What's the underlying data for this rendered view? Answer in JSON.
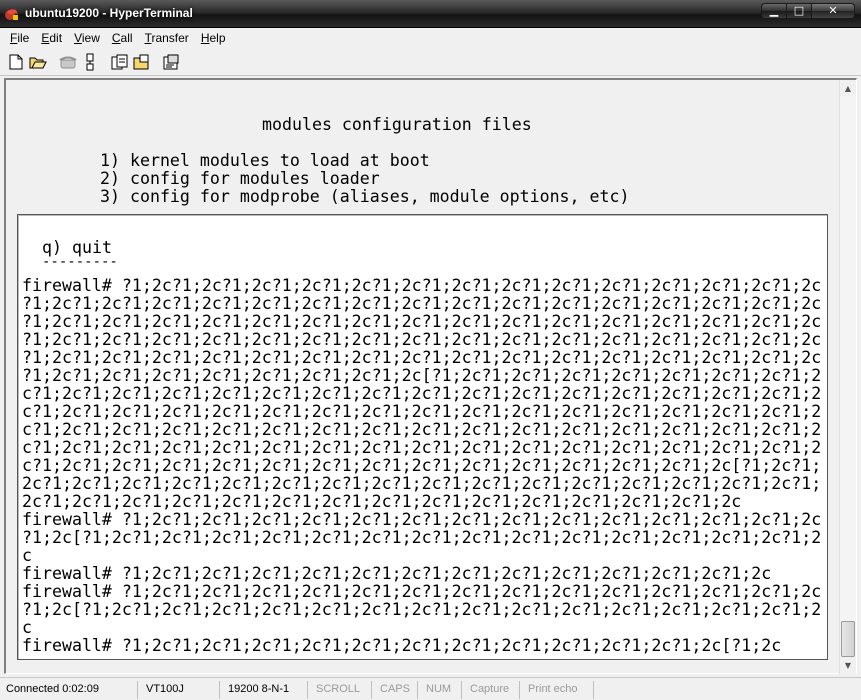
{
  "window": {
    "title": "ubuntu19200 - HyperTerminal",
    "buttons": {
      "minimize": "▁",
      "maximize": "□",
      "close": "✕"
    }
  },
  "menu": [
    "File",
    "Edit",
    "View",
    "Call",
    "Transfer",
    "Help"
  ],
  "toolbar": {
    "icons": [
      "new-document-icon",
      "open-folder-icon",
      "phone-icon",
      "disconnect-icon",
      "send-icon",
      "receive-icon",
      "properties-icon"
    ]
  },
  "terminal": {
    "menu_screen": {
      "heading": "modules configuration files",
      "options": [
        "1) kernel modules to load at boot",
        "2) config for modules loader",
        "3) config for modprobe (aliases, module options, etc)"
      ],
      "quit": "q) quit",
      "underline": "---------"
    },
    "lines": [
      "firewall# ?1;2c?1;2c?1;2c?1;2c?1;2c?1;2c?1;2c?1;2c?1;2c?1;2c?1;2c?1;2c?1;2c?1;2c",
      "?1;2c?1;2c?1;2c?1;2c?1;2c?1;2c?1;2c?1;2c?1;2c?1;2c?1;2c?1;2c?1;2c?1;2c?1;2c?1;2c",
      "?1;2c?1;2c?1;2c?1;2c?1;2c?1;2c?1;2c?1;2c?1;2c?1;2c?1;2c?1;2c?1;2c?1;2c?1;2c?1;2c",
      "?1;2c?1;2c?1;2c?1;2c?1;2c?1;2c?1;2c?1;2c?1;2c?1;2c?1;2c?1;2c?1;2c?1;2c?1;2c?1;2c",
      "?1;2c?1;2c?1;2c?1;2c?1;2c?1;2c?1;2c?1;2c?1;2c?1;2c?1;2c?1;2c?1;2c?1;2c?1;2c?1;2c",
      "?1;2c?1;2c?1;2c?1;2c?1;2c?1;2c?1;2c?1;2c[?1;2c?1;2c?1;2c?1;2c?1;2c?1;2c?1;2c?1;2",
      "c?1;2c?1;2c?1;2c?1;2c?1;2c?1;2c?1;2c?1;2c?1;2c?1;2c?1;2c?1;2c?1;2c?1;2c?1;2c?1;2",
      "c?1;2c?1;2c?1;2c?1;2c?1;2c?1;2c?1;2c?1;2c?1;2c?1;2c?1;2c?1;2c?1;2c?1;2c?1;2c?1;2",
      "c?1;2c?1;2c?1;2c?1;2c?1;2c?1;2c?1;2c?1;2c?1;2c?1;2c?1;2c?1;2c?1;2c?1;2c?1;2c?1;2",
      "c?1;2c?1;2c?1;2c?1;2c?1;2c?1;2c?1;2c?1;2c?1;2c?1;2c?1;2c?1;2c?1;2c?1;2c?1;2c?1;2",
      "c?1;2c?1;2c?1;2c?1;2c?1;2c?1;2c?1;2c?1;2c?1;2c?1;2c?1;2c?1;2c?1;2c?1;2c[?1;2c?1;",
      "2c?1;2c?1;2c?1;2c?1;2c?1;2c?1;2c?1;2c?1;2c?1;2c?1;2c?1;2c?1;2c?1;2c?1;2c?1;2c?1;",
      "2c?1;2c?1;2c?1;2c?1;2c?1;2c?1;2c?1;2c?1;2c?1;2c?1;2c?1;2c?1;2c?1;2c?1;2c",
      "firewall# ?1;2c?1;2c?1;2c?1;2c?1;2c?1;2c?1;2c?1;2c?1;2c?1;2c?1;2c?1;2c?1;2c?1;2c",
      "?1;2c[?1;2c?1;2c?1;2c?1;2c?1;2c?1;2c?1;2c?1;2c?1;2c?1;2c?1;2c?1;2c?1;2c?1;2c?1;2",
      "c",
      "firewall# ?1;2c?1;2c?1;2c?1;2c?1;2c?1;2c?1;2c?1;2c?1;2c?1;2c?1;2c?1;2c?1;2c",
      "firewall# ?1;2c?1;2c?1;2c?1;2c?1;2c?1;2c?1;2c?1;2c?1;2c?1;2c?1;2c?1;2c?1;2c?1;2c",
      "?1;2c[?1;2c?1;2c?1;2c?1;2c?1;2c?1;2c?1;2c?1;2c?1;2c?1;2c?1;2c?1;2c?1;2c?1;2c?1;2",
      "c",
      "firewall# ?1;2c?1;2c?1;2c?1;2c?1;2c?1;2c?1;2c?1;2c?1;2c?1;2c?1;2c?1;2c[?1;2c"
    ]
  },
  "status": {
    "connected": "Connected 0:02:09",
    "emulation": "VT100J",
    "settings": "19200 8-N-1",
    "scroll": "SCROLL",
    "caps": "CAPS",
    "num": "NUM",
    "capture": "Capture",
    "print_echo": "Print echo"
  }
}
